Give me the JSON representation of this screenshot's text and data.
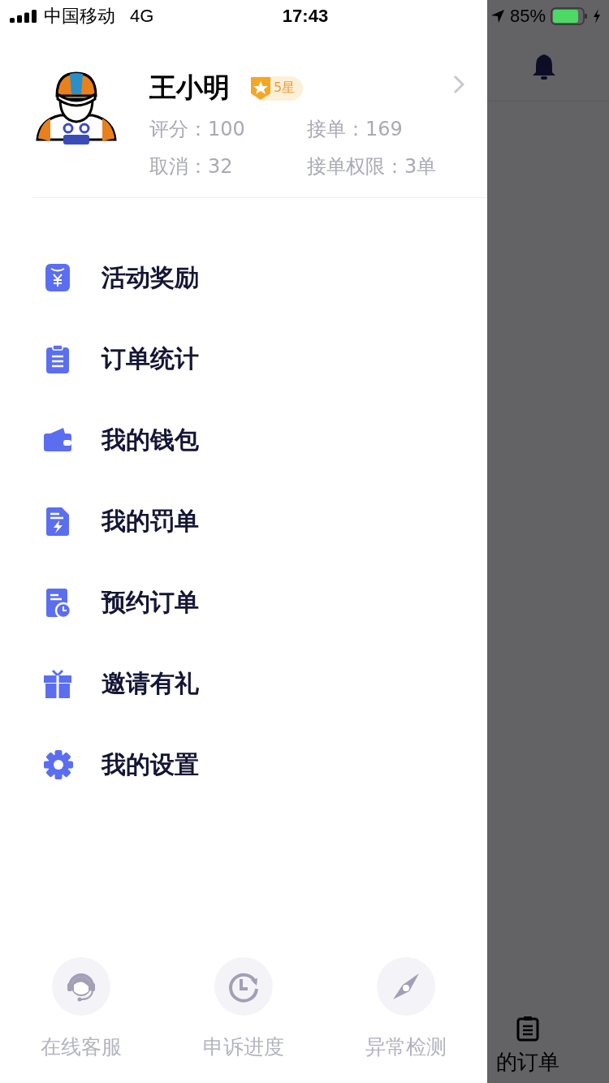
{
  "status_bar": {
    "carrier": "中国移动",
    "network": "4G",
    "time": "17:43",
    "battery": "85%"
  },
  "profile": {
    "name": "王小明",
    "badge": "5星",
    "stats": [
      {
        "text": "评分：100"
      },
      {
        "text": "接单：169"
      },
      {
        "text": "取消：32"
      },
      {
        "text": "接单权限：3单"
      }
    ]
  },
  "menu": [
    {
      "kind": "red-packet",
      "label": "活动奖励"
    },
    {
      "kind": "clipboard",
      "label": "订单统计"
    },
    {
      "kind": "wallet",
      "label": "我的钱包"
    },
    {
      "kind": "bolt-doc",
      "label": "我的罚单"
    },
    {
      "kind": "clock-doc",
      "label": "预约订单"
    },
    {
      "kind": "gift",
      "label": "邀请有礼"
    },
    {
      "kind": "gear",
      "label": "我的设置"
    }
  ],
  "footer_actions": [
    {
      "kind": "headset",
      "label": "在线客服"
    },
    {
      "kind": "history",
      "label": "申诉进度"
    },
    {
      "kind": "compass",
      "label": "异常检测"
    }
  ],
  "background_tab": {
    "label": "的订单"
  }
}
